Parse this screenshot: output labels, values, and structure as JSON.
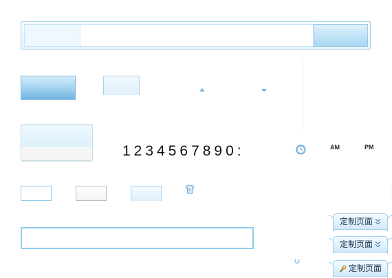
{
  "clock": {
    "digits": "1234567890:",
    "am": "AM",
    "pm": "PM"
  },
  "customize": {
    "tabs": [
      {
        "label": "定制页面",
        "icon": "double-chevron-down-icon"
      },
      {
        "label": "定制页面",
        "icon": "double-chevron-down-icon"
      },
      {
        "label": "定制页面",
        "icon": "wrench-icon"
      }
    ]
  },
  "colors": {
    "accent": "#8fcdf0",
    "button_gradient_bottom": "#6fb4e0",
    "text": "#111111"
  }
}
